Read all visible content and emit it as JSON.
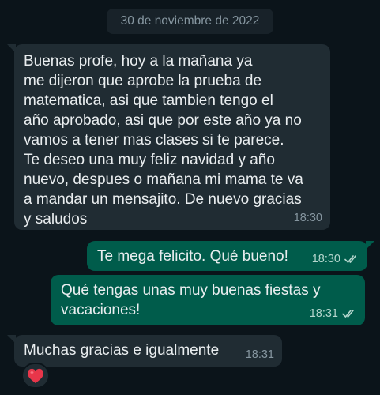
{
  "chat": {
    "date_divider": "30 de noviembre de 2022",
    "messages": [
      {
        "direction": "incoming",
        "text": "Buenas profe, hoy a la mañana ya\nme dijeron que aprobe la prueba de\nmatematica, asi que tambien tengo el\naño aprobado, asi que por este año ya no\nvamos a tener mas clases si te parece.\nTe deseo una muy feliz navidad y año\nnuevo, despues o mañana mi mama te va\na mandar un mensajito. De nuevo gracias\ny saludos",
        "time": "18:30"
      },
      {
        "direction": "outgoing",
        "text": "Te mega felicito. Qué bueno!",
        "time": "18:30",
        "status_icon": "double-check-icon"
      },
      {
        "direction": "outgoing",
        "text": "Qué tengas unas muy buenas fiestas y\nvacaciones!",
        "time": "18:31",
        "status_icon": "double-check-icon"
      },
      {
        "direction": "incoming",
        "text": "Muchas gracias e igualmente",
        "time": "18:31",
        "reaction": "heart-icon"
      }
    ]
  },
  "colors": {
    "background": "#0b141a",
    "incoming_bubble": "#202c33",
    "outgoing_bubble": "#005c4b",
    "text": "#e9edef",
    "timestamp": "#8696a0",
    "heart": "#e8364a"
  }
}
